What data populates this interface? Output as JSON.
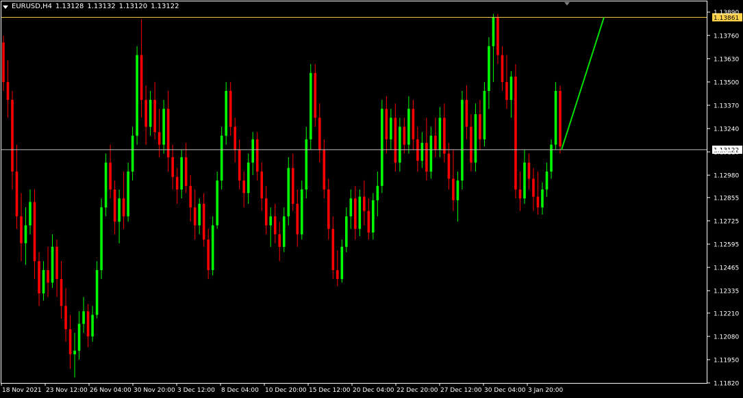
{
  "header": {
    "symbol_timeframe": "EURUSD,H4",
    "ohlc": [
      "1.13128",
      "1.13132",
      "1.13120",
      "1.13122"
    ]
  },
  "colors": {
    "background": "#000000",
    "frame": "#ffffff",
    "bull": "#00ff00",
    "bear": "#ff0000",
    "hline": "#c0c0c0",
    "hline_gold": "#ffd24a",
    "trend": "#00e000"
  },
  "chart_data": {
    "type": "candlestick",
    "symbol": "EURUSD",
    "timeframe": "H4",
    "ylim": [
      1.1182,
      1.1395
    ],
    "y_ticks": [
      "1.13890",
      "1.13760",
      "1.13630",
      "1.13500",
      "1.13370",
      "1.13240",
      "1.13110",
      "1.12980",
      "1.12855",
      "1.12725",
      "1.12595",
      "1.12465",
      "1.12335",
      "1.12210",
      "1.12080",
      "1.11950",
      "1.11820"
    ],
    "x_ticks": [
      "18 Nov 2021",
      "23 Nov 12:00",
      "26 Nov 04:00",
      "30 Nov 20:00",
      "3 Dec 12:00",
      "8 Dec 04:00",
      "10 Dec 20:00",
      "15 Dec 12:00",
      "20 Dec 04:00",
      "22 Dec 20:00",
      "27 Dec 12:00",
      "30 Dec 04:00",
      "3 Jan 20:00"
    ],
    "grid": false,
    "horizontal_levels": [
      {
        "label": "1.13861",
        "value": 1.13861,
        "style": "gold"
      },
      {
        "label": "1.13122",
        "value": 1.13122,
        "style": "current"
      }
    ],
    "trend_line": {
      "from_price": 1.13122,
      "to_price": 1.13861
    },
    "candles": [
      [
        1.1372,
        1.1376,
        1.1345,
        1.135
      ],
      [
        1.135,
        1.1362,
        1.133,
        1.134
      ],
      [
        1.134,
        1.1345,
        1.129,
        1.13
      ],
      [
        1.13,
        1.1315,
        1.1268,
        1.1275
      ],
      [
        1.1275,
        1.1288,
        1.125,
        1.126
      ],
      [
        1.126,
        1.128,
        1.1248,
        1.127
      ],
      [
        1.127,
        1.129,
        1.1265,
        1.1283
      ],
      [
        1.1283,
        1.129,
        1.124,
        1.125
      ],
      [
        1.125,
        1.1255,
        1.1225,
        1.1232
      ],
      [
        1.1232,
        1.125,
        1.1228,
        1.1245
      ],
      [
        1.1245,
        1.1258,
        1.123,
        1.1238
      ],
      [
        1.1238,
        1.1265,
        1.1235,
        1.1258
      ],
      [
        1.1258,
        1.1262,
        1.123,
        1.124
      ],
      [
        1.124,
        1.125,
        1.1218,
        1.1225
      ],
      [
        1.1225,
        1.1235,
        1.1205,
        1.1212
      ],
      [
        1.1212,
        1.122,
        1.119,
        1.1198
      ],
      [
        1.1198,
        1.121,
        1.1185,
        1.12
      ],
      [
        1.12,
        1.1222,
        1.1195,
        1.1215
      ],
      [
        1.1215,
        1.123,
        1.121,
        1.1222
      ],
      [
        1.1222,
        1.1226,
        1.1202,
        1.1208
      ],
      [
        1.1208,
        1.1225,
        1.1205,
        1.122
      ],
      [
        1.122,
        1.125,
        1.1218,
        1.1245
      ],
      [
        1.1245,
        1.1285,
        1.124,
        1.128
      ],
      [
        1.128,
        1.131,
        1.1275,
        1.1305
      ],
      [
        1.1305,
        1.1315,
        1.1285,
        1.129
      ],
      [
        1.129,
        1.1295,
        1.1265,
        1.1272
      ],
      [
        1.1272,
        1.129,
        1.126,
        1.1285
      ],
      [
        1.1285,
        1.13,
        1.1268,
        1.1275
      ],
      [
        1.1275,
        1.1305,
        1.1272,
        1.13
      ],
      [
        1.13,
        1.1325,
        1.1295,
        1.132
      ],
      [
        1.132,
        1.137,
        1.1315,
        1.1365
      ],
      [
        1.1365,
        1.1385,
        1.133,
        1.134
      ],
      [
        1.134,
        1.1348,
        1.1315,
        1.1325
      ],
      [
        1.1325,
        1.1345,
        1.132,
        1.134
      ],
      [
        1.134,
        1.135,
        1.1318,
        1.1322
      ],
      [
        1.1322,
        1.1335,
        1.1308,
        1.1315
      ],
      [
        1.1315,
        1.134,
        1.131,
        1.1335
      ],
      [
        1.1335,
        1.1345,
        1.13,
        1.1308
      ],
      [
        1.1308,
        1.1315,
        1.129,
        1.1297
      ],
      [
        1.1297,
        1.1302,
        1.1282,
        1.129
      ],
      [
        1.129,
        1.1312,
        1.1285,
        1.1308
      ],
      [
        1.1308,
        1.1316,
        1.1288,
        1.1292
      ],
      [
        1.1292,
        1.1298,
        1.1272,
        1.128
      ],
      [
        1.128,
        1.129,
        1.1262,
        1.127
      ],
      [
        1.127,
        1.1285,
        1.1265,
        1.1282
      ],
      [
        1.1282,
        1.1288,
        1.1258,
        1.1262
      ],
      [
        1.1262,
        1.1268,
        1.124,
        1.1245
      ],
      [
        1.1245,
        1.1275,
        1.1242,
        1.127
      ],
      [
        1.127,
        1.13,
        1.1268,
        1.1295
      ],
      [
        1.1295,
        1.1325,
        1.129,
        1.132
      ],
      [
        1.132,
        1.135,
        1.1315,
        1.1345
      ],
      [
        1.1345,
        1.135,
        1.132,
        1.1325
      ],
      [
        1.1325,
        1.133,
        1.1305,
        1.1312
      ],
      [
        1.1312,
        1.1318,
        1.129,
        1.1295
      ],
      [
        1.1295,
        1.13,
        1.128,
        1.1288
      ],
      [
        1.1288,
        1.131,
        1.1282,
        1.1305
      ],
      [
        1.1305,
        1.1322,
        1.1298,
        1.1318
      ],
      [
        1.1318,
        1.1322,
        1.1295,
        1.13
      ],
      [
        1.13,
        1.1305,
        1.1278,
        1.1285
      ],
      [
        1.1285,
        1.1292,
        1.1265,
        1.127
      ],
      [
        1.127,
        1.128,
        1.1258,
        1.1275
      ],
      [
        1.1275,
        1.1282,
        1.126,
        1.1265
      ],
      [
        1.1265,
        1.1272,
        1.125,
        1.1258
      ],
      [
        1.1258,
        1.128,
        1.1255,
        1.1275
      ],
      [
        1.1275,
        1.1308,
        1.127,
        1.1302
      ],
      [
        1.1302,
        1.131,
        1.1278,
        1.1282
      ],
      [
        1.1282,
        1.129,
        1.1258,
        1.1265
      ],
      [
        1.1265,
        1.1295,
        1.1262,
        1.129
      ],
      [
        1.129,
        1.1325,
        1.1285,
        1.1318
      ],
      [
        1.1318,
        1.136,
        1.1312,
        1.1355
      ],
      [
        1.1355,
        1.136,
        1.1325,
        1.133
      ],
      [
        1.133,
        1.1338,
        1.1305,
        1.1312
      ],
      [
        1.1312,
        1.1318,
        1.1285,
        1.129
      ],
      [
        1.129,
        1.1296,
        1.1262,
        1.1268
      ],
      [
        1.1268,
        1.1275,
        1.124,
        1.1245
      ],
      [
        1.1245,
        1.1256,
        1.1236,
        1.124
      ],
      [
        1.124,
        1.1262,
        1.1238,
        1.1258
      ],
      [
        1.1258,
        1.128,
        1.1255,
        1.1275
      ],
      [
        1.1275,
        1.129,
        1.1268,
        1.1285
      ],
      [
        1.1285,
        1.1292,
        1.1262,
        1.1268
      ],
      [
        1.1268,
        1.129,
        1.1264,
        1.1286
      ],
      [
        1.1286,
        1.1295,
        1.127,
        1.1278
      ],
      [
        1.1278,
        1.1285,
        1.1262,
        1.1266
      ],
      [
        1.1266,
        1.1288,
        1.1262,
        1.1284
      ],
      [
        1.1284,
        1.13,
        1.1275,
        1.1292
      ],
      [
        1.1292,
        1.134,
        1.1288,
        1.1335
      ],
      [
        1.1335,
        1.1342,
        1.131,
        1.1318
      ],
      [
        1.1318,
        1.1335,
        1.1312,
        1.133
      ],
      [
        1.133,
        1.1338,
        1.13,
        1.1305
      ],
      [
        1.1305,
        1.133,
        1.13,
        1.1325
      ],
      [
        1.1325,
        1.133,
        1.131,
        1.1315
      ],
      [
        1.1315,
        1.1342,
        1.131,
        1.1335
      ],
      [
        1.1335,
        1.134,
        1.1312,
        1.1318
      ],
      [
        1.1318,
        1.1325,
        1.13,
        1.1306
      ],
      [
        1.1306,
        1.1322,
        1.1302,
        1.1316
      ],
      [
        1.1316,
        1.133,
        1.1295,
        1.13
      ],
      [
        1.13,
        1.1325,
        1.1296,
        1.132
      ],
      [
        1.132,
        1.133,
        1.1308,
        1.1312
      ],
      [
        1.1312,
        1.1336,
        1.1308,
        1.133
      ],
      [
        1.133,
        1.1338,
        1.1305,
        1.131
      ],
      [
        1.131,
        1.1316,
        1.129,
        1.1296
      ],
      [
        1.1296,
        1.1312,
        1.1278,
        1.1284
      ],
      [
        1.1284,
        1.13,
        1.1272,
        1.1295
      ],
      [
        1.1295,
        1.1345,
        1.129,
        1.134
      ],
      [
        1.134,
        1.1348,
        1.1318,
        1.1325
      ],
      [
        1.1325,
        1.1332,
        1.13,
        1.1305
      ],
      [
        1.1305,
        1.1338,
        1.13,
        1.1332
      ],
      [
        1.1332,
        1.134,
        1.1312,
        1.1318
      ],
      [
        1.1318,
        1.135,
        1.1314,
        1.1345
      ],
      [
        1.1345,
        1.1375,
        1.1335,
        1.137
      ],
      [
        1.137,
        1.1388,
        1.135,
        1.1386
      ],
      [
        1.1386,
        1.1388,
        1.136,
        1.1365
      ],
      [
        1.1365,
        1.137,
        1.1345,
        1.135
      ],
      [
        1.135,
        1.1365,
        1.1335,
        1.134
      ],
      [
        1.134,
        1.1356,
        1.133,
        1.1353
      ],
      [
        1.1353,
        1.136,
        1.1285,
        1.129
      ],
      [
        1.129,
        1.13,
        1.1278,
        1.1285
      ],
      [
        1.1285,
        1.1312,
        1.1282,
        1.1305
      ],
      [
        1.1305,
        1.131,
        1.129,
        1.1296
      ],
      [
        1.1296,
        1.1302,
        1.1278,
        1.1286
      ],
      [
        1.1286,
        1.13,
        1.1276,
        1.128
      ],
      [
        1.128,
        1.1294,
        1.1276,
        1.129
      ],
      [
        1.129,
        1.1305,
        1.1286,
        1.13
      ],
      [
        1.13,
        1.1318,
        1.1296,
        1.1315
      ],
      [
        1.1315,
        1.135,
        1.1312,
        1.1345
      ],
      [
        1.1345,
        1.1348,
        1.131,
        1.1314
      ]
    ]
  }
}
